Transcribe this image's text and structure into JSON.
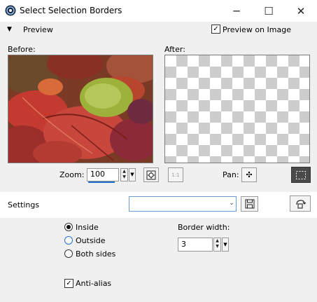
{
  "window": {
    "title": "Select Selection Borders",
    "minimize_glyph": "─",
    "maximize_glyph": "☐",
    "close_glyph": "✕",
    "app_icon": "paintshop-app-icon"
  },
  "preview": {
    "section_label": "Preview",
    "toggle_icon": "triangle-down-icon",
    "toggle_glyph": "▼",
    "preview_on_image_label": "Preview on Image",
    "preview_on_image_checked": true,
    "check_glyph": "✓",
    "before_label": "Before:",
    "after_label": "After:",
    "zoom_label": "Zoom:",
    "zoom_value": "100",
    "zoom_1to1_label": "1:1",
    "pan_label": "Pan:",
    "spin_up": "▲",
    "spin_down": "▼",
    "drop_glyph": "▼",
    "pan_glyph": "✣"
  },
  "settings": {
    "label": "Settings",
    "preset_value": "",
    "preset_arrow": "⌄",
    "options": [
      {
        "label": "Inside",
        "selected": true
      },
      {
        "label": "Outside",
        "selected": false
      },
      {
        "label": "Both sides",
        "selected": false
      }
    ],
    "border_width_label": "Border width:",
    "border_width_value": "3",
    "anti_alias_label": "Anti-alias",
    "anti_alias_checked": true
  },
  "colors": {
    "accent": "#1e6fd0",
    "panel_bg": "#f0f0f0",
    "marquee_button_bg": "#4a4a4a"
  }
}
